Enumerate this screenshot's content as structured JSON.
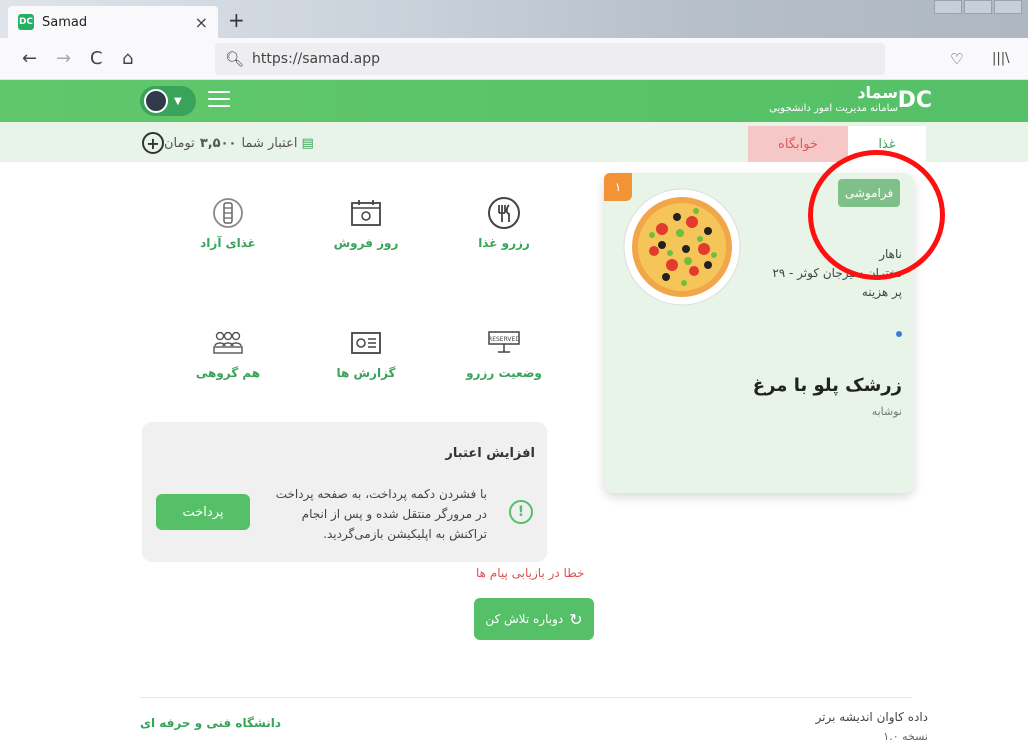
{
  "browser": {
    "tab_title": "Samad",
    "favicon_text": "DC",
    "tab_close": "×",
    "new_tab": "+",
    "url": "https://samad.app",
    "back": "←",
    "forward": "→",
    "reload": "C",
    "home": "⌂",
    "pocket": "♡",
    "library": "|||\\"
  },
  "header": {
    "brand_title": "سماد",
    "brand_subtitle": "سامانه مدیریت امور دانشجویی",
    "logo": "DC"
  },
  "subheader": {
    "credit_label": "اعتبار شما",
    "credit_amount": "۳,۵۰۰",
    "credit_unit": "تومان",
    "add_icon": "+",
    "tabs": [
      {
        "label": "خوابگاه"
      },
      {
        "label": "غذا"
      }
    ]
  },
  "tiles": [
    {
      "label": "رزرو غذا",
      "icon": "utensils-icon"
    },
    {
      "label": "روز فروش",
      "icon": "calendar-icon"
    },
    {
      "label": "غذای آزاد",
      "icon": "free-food-icon"
    },
    {
      "label": "وضعیت رزرو",
      "icon": "reserved-icon"
    },
    {
      "label": "گزارش ها",
      "icon": "report-icon"
    },
    {
      "label": "هم گروهی",
      "icon": "group-icon"
    }
  ],
  "credit_box": {
    "title": "افزایش اعتبار",
    "text": "با فشردن دکمه پرداخت، به صفحه پرداخت در مرورگر منتقل شده و پس از انجام تراکنش به اپلیکیشن بازمی‌گردید.",
    "pay_label": "پرداخت"
  },
  "messages": {
    "error": "خطا در بازیابی پیام ها",
    "retry_label": "دوباره تلاش کن"
  },
  "food_card": {
    "badge": "۱",
    "forget_label": "فراموشی",
    "meal": "ناهار",
    "location": "دختران سیرجان کوثر - ۲۹",
    "cost_type": "پر هزینه",
    "food_name": "زرشک پلو با مرغ",
    "extra": "نوشابه"
  },
  "footer": {
    "company": "داده کاوان اندیشه برتر",
    "version": "نسخه ۱.۰",
    "university": "دانشگاه فنی و حرفه ای"
  },
  "colors": {
    "brand_green": "#55c068",
    "highlight_red": "#ff1010",
    "badge_orange": "#f29436"
  }
}
